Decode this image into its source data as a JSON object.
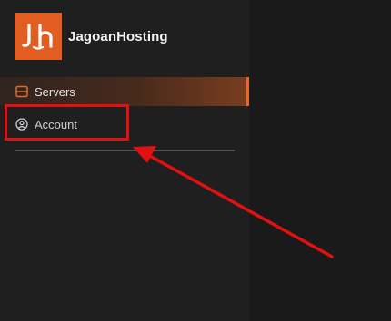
{
  "brand": {
    "name": "JagoanHosting",
    "logo_text": "Jh",
    "logo_color": "#e25d22"
  },
  "nav": {
    "items": [
      {
        "label": "Servers",
        "icon": "server-icon",
        "active": true
      },
      {
        "label": "Account",
        "icon": "user-circle-icon",
        "active": false
      }
    ]
  },
  "annotation": {
    "color": "#e11111",
    "highlight_target": "Account",
    "arrow": "pointing-to-account"
  },
  "colors": {
    "accent": "#e8692b",
    "sidebar_bg": "#1f1f1f",
    "main_bg": "#1a1a1a"
  }
}
